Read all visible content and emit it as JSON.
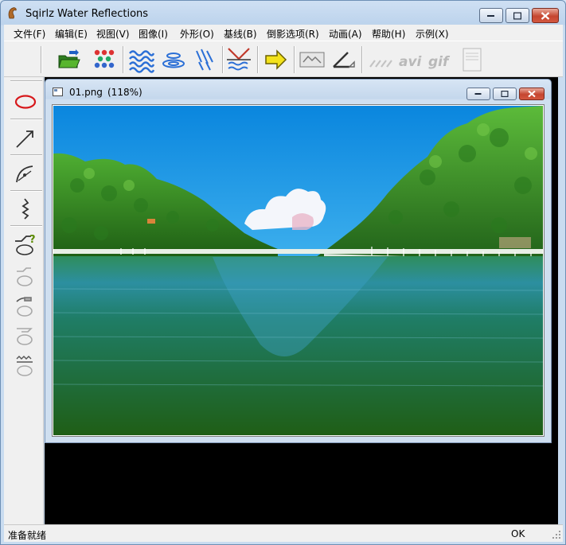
{
  "window": {
    "title": "Sqirlz Water Reflections",
    "minimize": "minimize",
    "maximize": "maximize",
    "close": "close"
  },
  "menu": [
    {
      "label": "文件(F)"
    },
    {
      "label": "编辑(E)"
    },
    {
      "label": "视图(V)"
    },
    {
      "label": "图像(I)"
    },
    {
      "label": "外形(O)"
    },
    {
      "label": "基线(B)"
    },
    {
      "label": "倒影选项(R)"
    },
    {
      "label": "动画(A)"
    },
    {
      "label": "帮助(H)"
    },
    {
      "label": "示例(X)"
    }
  ],
  "toolbar": {
    "icons": [
      "open-folder-icon",
      "color-dots-icon",
      "waves-icon",
      "ripples-icon",
      "rain-icon",
      "baseline-reflection-icon",
      "arrow-right-icon",
      "image-frame-icon",
      "angle-icon",
      "wave-strokes-icon",
      "avi-icon",
      "gif-icon",
      "panel-icon"
    ],
    "avi_label": "avi",
    "gif_label": "gif"
  },
  "left_tools": [
    "ellipse-icon",
    "arrow-icon",
    "curve-icon",
    "zigzag-icon",
    "reflection-help-icon",
    "reflection-1-icon",
    "reflection-2-icon",
    "reflection-3-icon",
    "reflection-4-icon"
  ],
  "document": {
    "title": "01.png",
    "zoom": "(118%)"
  },
  "status": {
    "text": "准备就绪",
    "ok": "OK"
  },
  "colors": {
    "sky": "#1b8fe2",
    "water": "#1e6a2a",
    "accent_close": "#c54630"
  }
}
